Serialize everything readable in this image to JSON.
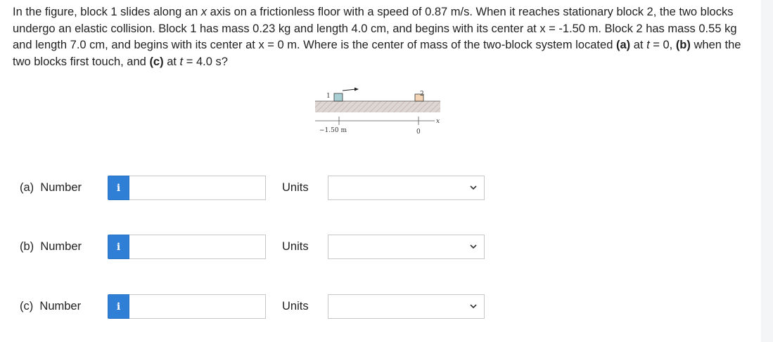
{
  "question": {
    "s1": "In the figure, block 1 slides along an ",
    "var_x": "x",
    "s2": " axis on a frictionless floor with a speed of 0.87 m/s. When it reaches stationary block 2, the two blocks undergo an elastic collision. Block 1 has mass 0.23 kg and length 4.0 cm, and begins with its center at x = -1.50 m. Block 2 has mass 0.55 kg and length 7.0 cm, and begins with its center at x = 0 m. Where is the center of mass of the two-block system located ",
    "part_a": "(a)",
    "s3": " at ",
    "var_t1": "t",
    "s4": " = 0, ",
    "part_b": "(b)",
    "s5": " when the two blocks first touch, and ",
    "part_c": "(c)",
    "s6": " at ",
    "var_t2": "t",
    "s7": " = 4.0 s?"
  },
  "figure": {
    "block1_label": "1",
    "block2_label": "2",
    "axis_var": "x",
    "tick_left": "−1.50 m",
    "tick_right": "0",
    "colors": {
      "block1": "#a8cfd4",
      "block2": "#f3d4b4",
      "floor": "#d8d0cd"
    }
  },
  "parts": [
    {
      "label": "(a)",
      "field_label": "Number",
      "info": "i",
      "units_label": "Units",
      "value": "",
      "units_value": ""
    },
    {
      "label": "(b)",
      "field_label": "Number",
      "info": "i",
      "units_label": "Units",
      "value": "",
      "units_value": ""
    },
    {
      "label": "(c)",
      "field_label": "Number",
      "info": "i",
      "units_label": "Units",
      "value": "",
      "units_value": ""
    }
  ],
  "colors": {
    "info_button": "#2f7fd6",
    "border": "#c8c8c8"
  }
}
